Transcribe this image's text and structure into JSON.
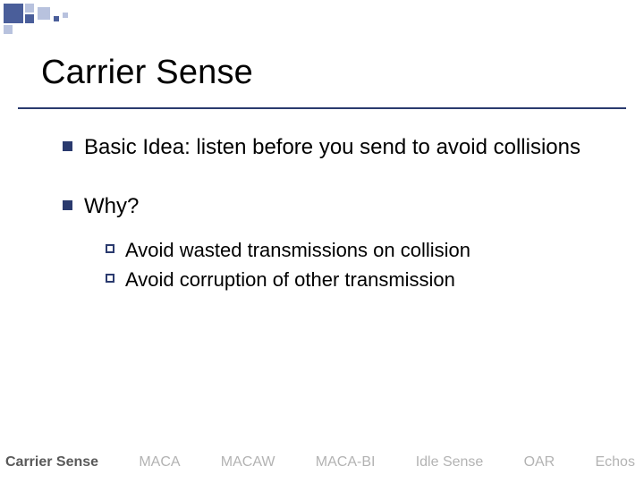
{
  "title": "Carrier Sense",
  "bullets": [
    {
      "text": "Basic Idea:  listen before you send to avoid collisions"
    },
    {
      "text": "Why?",
      "sub": [
        "Avoid wasted transmissions on collision",
        "Avoid corruption of other transmission"
      ]
    }
  ],
  "footer_nav": [
    "Carrier Sense",
    "MACA",
    "MACAW",
    "MACA-BI",
    "Idle Sense",
    "OAR",
    "Echos"
  ],
  "footer_active_index": 0
}
